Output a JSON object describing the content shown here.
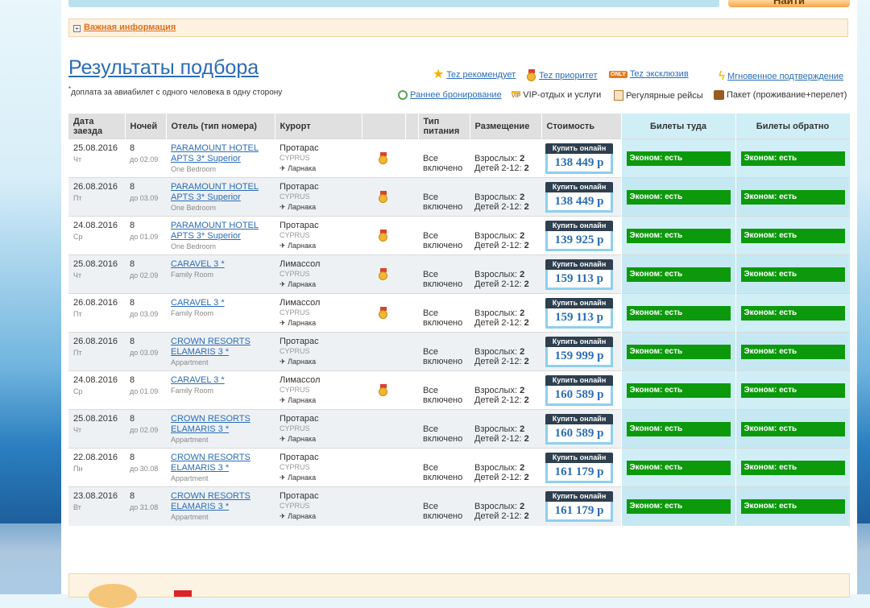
{
  "top": {
    "find_button": "Найти"
  },
  "info": {
    "label": "Важная информация"
  },
  "header": {
    "title": "Результаты подбора",
    "note_mark": "*",
    "note": "доплата за авиабилет с одного человека в одну сторону"
  },
  "legend": {
    "recommend": "Tez рекомендует",
    "priority": "Tez приоритет",
    "exclusive": "Tez эксклюзив",
    "only_badge": "ONLY",
    "instant": "Мгновенное подтверждение",
    "early": "Раннее бронирование",
    "vip": "VIP-отдых и услуги",
    "vip_badge": "VIP",
    "regular": "Регулярные рейсы",
    "package": "Пакет (проживание+перелет)"
  },
  "columns": {
    "date": "Дата заезда",
    "nights": "Ночей",
    "hotel": "Отель (тип номера)",
    "resort": "Курорт",
    "meal": "Тип питания",
    "accommodation": "Размещение",
    "price": "Стоимость",
    "tickets_to": "Билеты туда",
    "tickets_back": "Билеты обратно"
  },
  "labels": {
    "adults": "Взрослых:",
    "children": "Детей 2-12:",
    "buy": "Купить онлайн",
    "meal_line1": "Все",
    "meal_line2": "включено",
    "ticket": "Эконом: есть",
    "airport": "Ларнака"
  },
  "rows": [
    {
      "date": "25.08.2016",
      "dow": "Чт",
      "nights": "8",
      "until": "до 02.09",
      "hotel1": "PARAMOUNT HOTEL",
      "hotel2": "APTS 3* Superior",
      "room": "One Bedroom",
      "resort": "Протарас",
      "country": "CYPRUS",
      "medal": true,
      "adults": "2",
      "children": "2",
      "price": "138 449 р"
    },
    {
      "date": "26.08.2016",
      "dow": "Пт",
      "nights": "8",
      "until": "до 03.09",
      "hotel1": "PARAMOUNT HOTEL",
      "hotel2": "APTS 3* Superior",
      "room": "One Bedroom",
      "resort": "Протарас",
      "country": "CYPRUS",
      "medal": true,
      "adults": "2",
      "children": "2",
      "price": "138 449 р"
    },
    {
      "date": "24.08.2016",
      "dow": "Ср",
      "nights": "8",
      "until": "до 01.09",
      "hotel1": "PARAMOUNT HOTEL",
      "hotel2": "APTS 3* Superior",
      "room": "One Bedroom",
      "resort": "Протарас",
      "country": "CYPRUS",
      "medal": true,
      "adults": "2",
      "children": "2",
      "price": "139 925 р"
    },
    {
      "date": "25.08.2016",
      "dow": "Чт",
      "nights": "8",
      "until": "до 02.09",
      "hotel1": "CARAVEL 3 *",
      "hotel2": "",
      "room": "Family Room",
      "resort": "Лимассол",
      "country": "CYPRUS",
      "medal": true,
      "adults": "2",
      "children": "2",
      "price": "159 113 р"
    },
    {
      "date": "26.08.2016",
      "dow": "Пт",
      "nights": "8",
      "until": "до 03.09",
      "hotel1": "CARAVEL 3 *",
      "hotel2": "",
      "room": "Family Room",
      "resort": "Лимассол",
      "country": "CYPRUS",
      "medal": true,
      "adults": "2",
      "children": "2",
      "price": "159 113 р"
    },
    {
      "date": "26.08.2016",
      "dow": "Пт",
      "nights": "8",
      "until": "до 03.09",
      "hotel1": "CROWN RESORTS",
      "hotel2": "ELAMARIS 3 *",
      "room": "Appartment",
      "resort": "Протарас",
      "country": "CYPRUS",
      "medal": false,
      "adults": "2",
      "children": "2",
      "price": "159 999 р"
    },
    {
      "date": "24.08.2016",
      "dow": "Ср",
      "nights": "8",
      "until": "до 01.09",
      "hotel1": "CARAVEL 3 *",
      "hotel2": "",
      "room": "Family Room",
      "resort": "Лимассол",
      "country": "CYPRUS",
      "medal": true,
      "adults": "2",
      "children": "2",
      "price": "160 589 р"
    },
    {
      "date": "25.08.2016",
      "dow": "Чт",
      "nights": "8",
      "until": "до 02.09",
      "hotel1": "CROWN RESORTS",
      "hotel2": "ELAMARIS 3 *",
      "room": "Appartment",
      "resort": "Протарас",
      "country": "CYPRUS",
      "medal": false,
      "adults": "2",
      "children": "2",
      "price": "160 589 р"
    },
    {
      "date": "22.08.2016",
      "dow": "Пн",
      "nights": "8",
      "until": "до 30.08",
      "hotel1": "CROWN RESORTS",
      "hotel2": "ELAMARIS 3 *",
      "room": "Appartment",
      "resort": "Протарас",
      "country": "CYPRUS",
      "medal": false,
      "adults": "2",
      "children": "2",
      "price": "161 179 р"
    },
    {
      "date": "23.08.2016",
      "dow": "Вт",
      "nights": "8",
      "until": "до 31.08",
      "hotel1": "CROWN RESORTS",
      "hotel2": "ELAMARIS 3 *",
      "room": "Appartment",
      "resort": "Протарас",
      "country": "CYPRUS",
      "medal": false,
      "adults": "2",
      "children": "2",
      "price": "161 179 р"
    }
  ]
}
